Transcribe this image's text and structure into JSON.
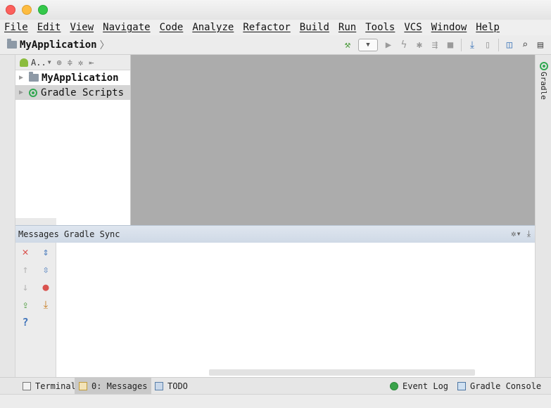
{
  "menu": [
    "File",
    "Edit",
    "View",
    "Navigate",
    "Code",
    "Analyze",
    "Refactor",
    "Build",
    "Run",
    "Tools",
    "VCS",
    "Window",
    "Help"
  ],
  "navbar": {
    "project_name": "MyApplication",
    "separator": "〉"
  },
  "project_panel": {
    "view_selector": "A..",
    "tree": [
      {
        "label": "MyApplication",
        "expanded": false
      },
      {
        "label": "Gradle Scripts",
        "expanded": false
      }
    ]
  },
  "right_tool": {
    "label": "Gradle"
  },
  "messages": {
    "title": "Messages Gradle Sync"
  },
  "bottom_tabs": {
    "terminal": "Terminal",
    "messages": "0: Messages",
    "todo": "TODO",
    "event_log": "Event Log",
    "gradle_console": "Gradle Console"
  }
}
